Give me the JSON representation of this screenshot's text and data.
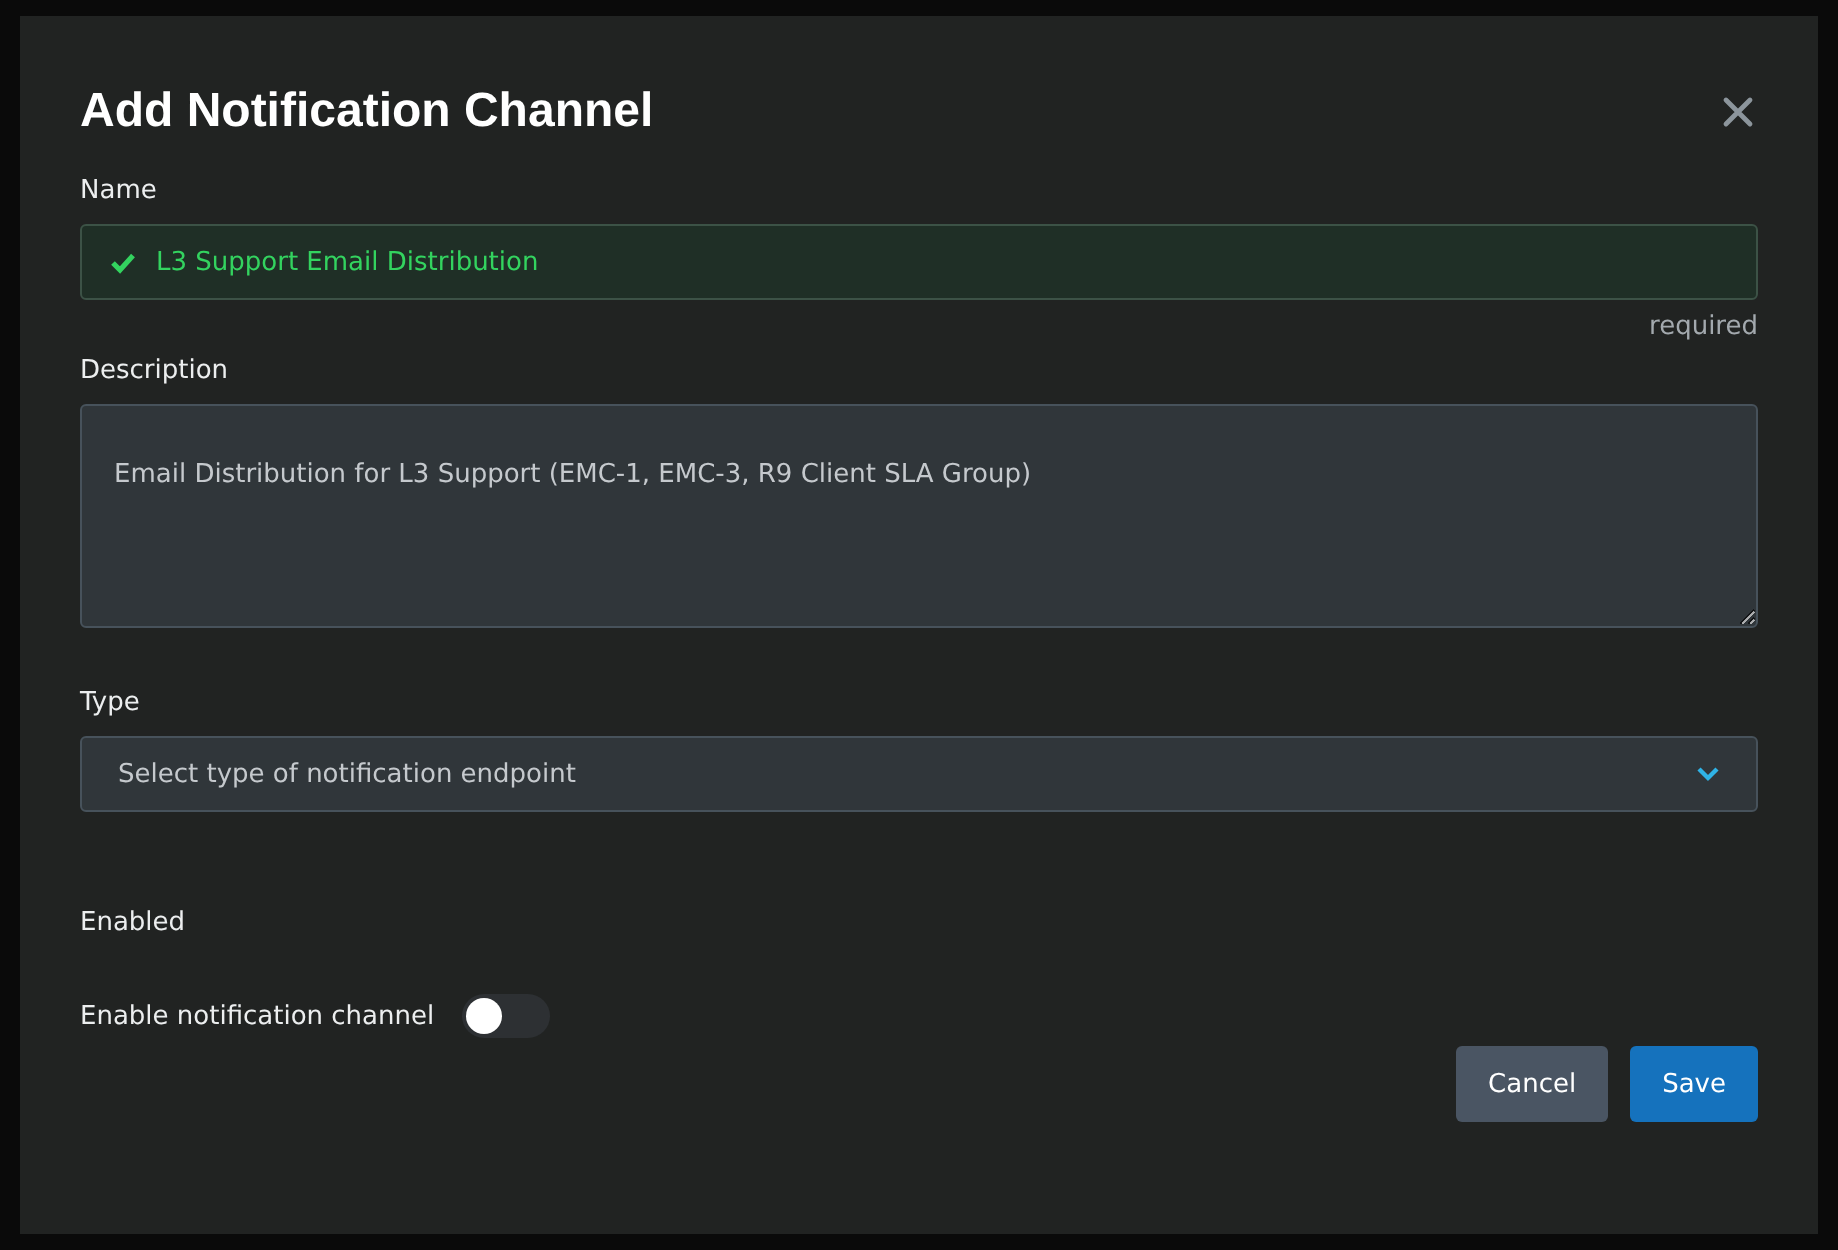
{
  "dialog": {
    "title": "Add Notification Channel"
  },
  "name_field": {
    "label": "Name",
    "value": "L3 Support Email Distribution",
    "valid": true,
    "hint": "required"
  },
  "description_field": {
    "label": "Description",
    "value": "Email Distribution for L3 Support (EMC-1, EMC-3, R9 Client SLA Group)"
  },
  "type_field": {
    "label": "Type",
    "placeholder": "Select type of notification endpoint"
  },
  "enabled_section": {
    "heading": "Enabled",
    "label": "Enable notification channel",
    "on": false
  },
  "buttons": [
    {
      "label": "Cancel",
      "kind": "secondary"
    },
    {
      "label": "Save",
      "kind": "primary"
    }
  ]
}
